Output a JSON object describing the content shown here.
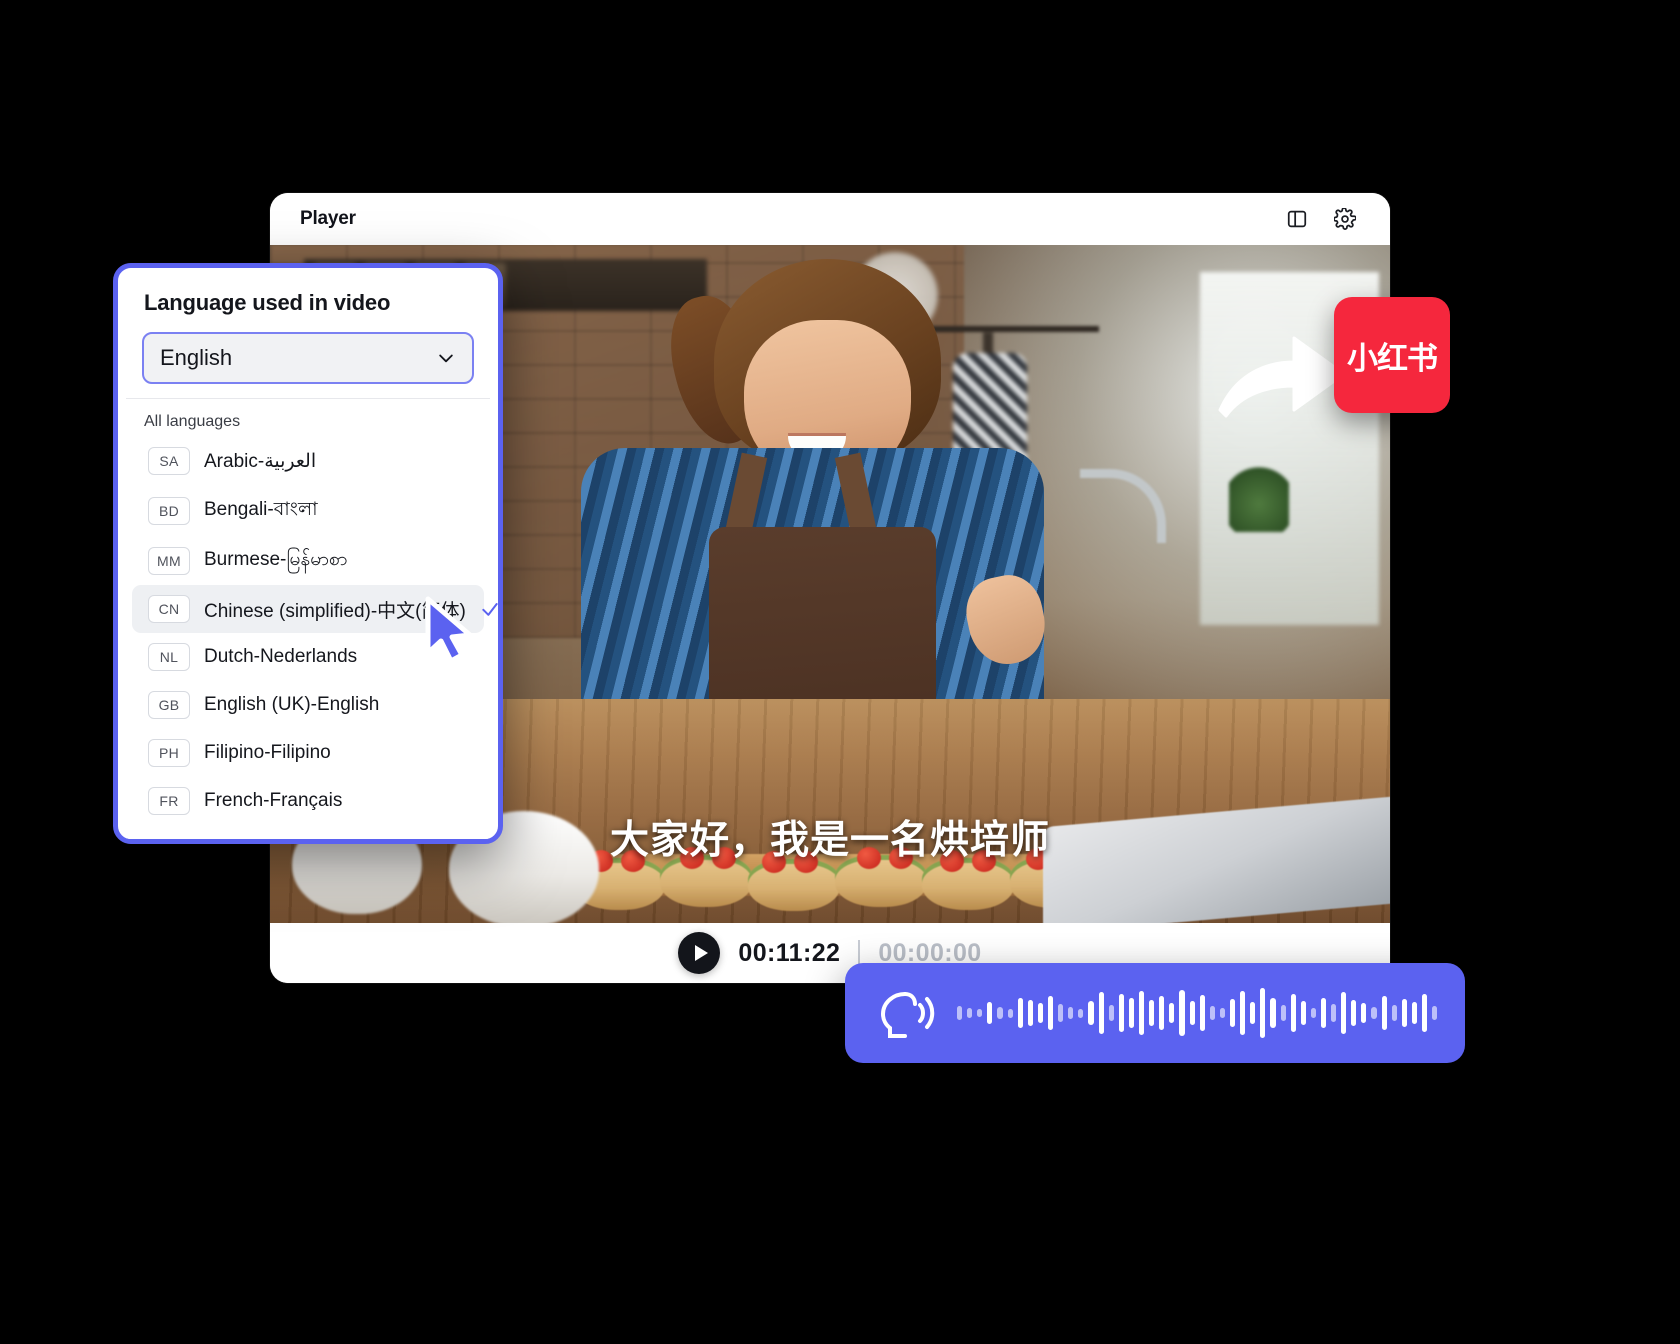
{
  "player": {
    "title": "Player",
    "icons": [
      {
        "name": "layout-panel-icon"
      },
      {
        "name": "gear-icon"
      }
    ],
    "subtitle_text": "大家好，我是一名烘培师",
    "controls": {
      "play_icon": "play-icon",
      "current_time": "00:11:22",
      "total_time": "00:00:00"
    }
  },
  "language_panel": {
    "title": "Language used in video",
    "selected_value": "English",
    "chevron_icon": "chevron-down-icon",
    "group_label": "All languages",
    "items": [
      {
        "code": "SA",
        "label": "Arabic-العربية",
        "selected": false
      },
      {
        "code": "BD",
        "label": "Bengali-বাংলা",
        "selected": false
      },
      {
        "code": "MM",
        "label": "Burmese-မြန်မာစာ",
        "selected": false
      },
      {
        "code": "CN",
        "label": "Chinese (simplified)-中文(简体)",
        "selected": true
      },
      {
        "code": "NL",
        "label": "Dutch-Nederlands",
        "selected": false
      },
      {
        "code": "GB",
        "label": "English (UK)-English",
        "selected": false
      },
      {
        "code": "PH",
        "label": "Filipino-Filipino",
        "selected": false
      },
      {
        "code": "FR",
        "label": "French-Français",
        "selected": false
      }
    ]
  },
  "share_badge": {
    "label": "小红书",
    "color": "#f5273d",
    "arrow_icon": "share-arrow-icon"
  },
  "waveform": {
    "icon": "speaking-head-icon",
    "color": "#5b62f0",
    "bars": [
      14,
      10,
      8,
      22,
      12,
      9,
      30,
      26,
      20,
      34,
      18,
      12,
      9,
      24,
      42,
      16,
      38,
      30,
      44,
      26,
      34,
      20,
      46,
      24,
      36,
      14,
      10,
      28,
      44,
      22,
      50,
      30,
      16,
      38,
      24,
      10,
      30,
      18,
      42,
      26,
      20,
      12,
      34,
      16,
      28,
      22,
      38,
      14
    ]
  },
  "colors": {
    "accent": "#5b62f0",
    "badge_red": "#f5273d",
    "text_dark": "#14161c"
  }
}
